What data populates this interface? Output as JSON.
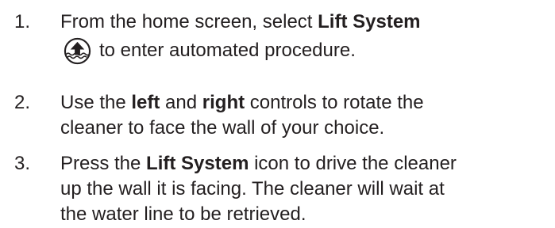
{
  "steps": [
    {
      "number": "1.",
      "line1_prefix": "From the home screen, select ",
      "line1_bold": "Lift System",
      "line2": "to enter automated procedure.",
      "icon": "lift-system-icon"
    },
    {
      "number": "2.",
      "line1_a": "Use the ",
      "line1_bold_a": "left",
      "line1_b": " and ",
      "line1_bold_b": "right",
      "line1_c": " controls to rotate the",
      "line2": "cleaner to face the wall of your choice."
    },
    {
      "number": "3.",
      "line1_a": "Press the ",
      "line1_bold": "Lift System",
      "line1_b": " icon to drive the cleaner",
      "line2": "up the wall it is facing. The cleaner will wait at",
      "line3": "the water line to be retrieved."
    }
  ],
  "colors": {
    "text": "#231f20",
    "background": "#ffffff"
  }
}
